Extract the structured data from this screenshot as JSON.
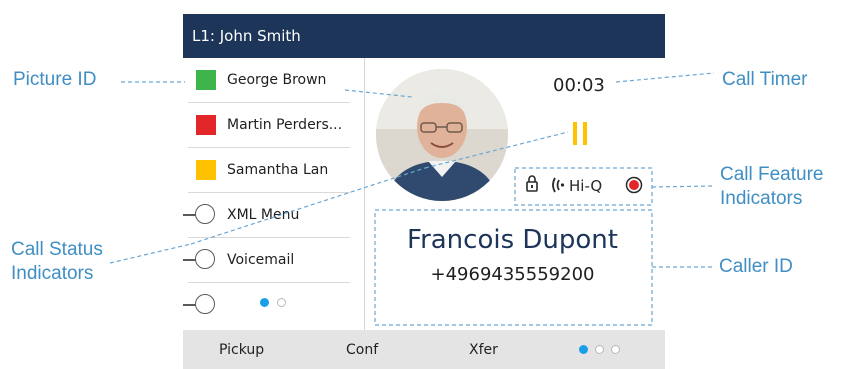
{
  "annotations": {
    "picture_id": "Picture ID",
    "call_status": "Call Status\nIndicators",
    "call_timer": "Call Timer",
    "call_feature": "Call Feature\nIndicators",
    "caller_id": "Caller ID"
  },
  "phone": {
    "title": "L1: John Smith",
    "line_keys": [
      {
        "label": "George Brown",
        "status": "green",
        "status_color": "#3db54a"
      },
      {
        "label": "Martin Perders...",
        "status": "red",
        "status_color": "#e2262a"
      },
      {
        "label": "Samantha Lan",
        "status": "yellow",
        "status_color": "#ffc200"
      },
      {
        "label": "XML Menu",
        "status": "circle"
      },
      {
        "label": "Voicemail",
        "status": "circle"
      },
      {
        "label": "",
        "status": "circle"
      }
    ],
    "sidebar_pages": {
      "current": 1,
      "total": 2
    },
    "call": {
      "timer": "00:03",
      "status_icon": "pause-icon",
      "features": {
        "lock_icon": "lock-icon",
        "hiq_label": "Hi-Q",
        "record_icon": "record-icon"
      },
      "caller_name": "Francois Dupont",
      "caller_number": "+4969435559200"
    },
    "softkeys": [
      "Pickup",
      "Conf",
      "Xfer"
    ],
    "softkey_pages": {
      "current": 1,
      "total": 3
    }
  },
  "colors": {
    "title_bar": "#1c3558",
    "accent_blue": "#1a9ee8",
    "annotation_text": "#3f8ec4",
    "pause": "#ffc200",
    "record": "#e2262a"
  }
}
